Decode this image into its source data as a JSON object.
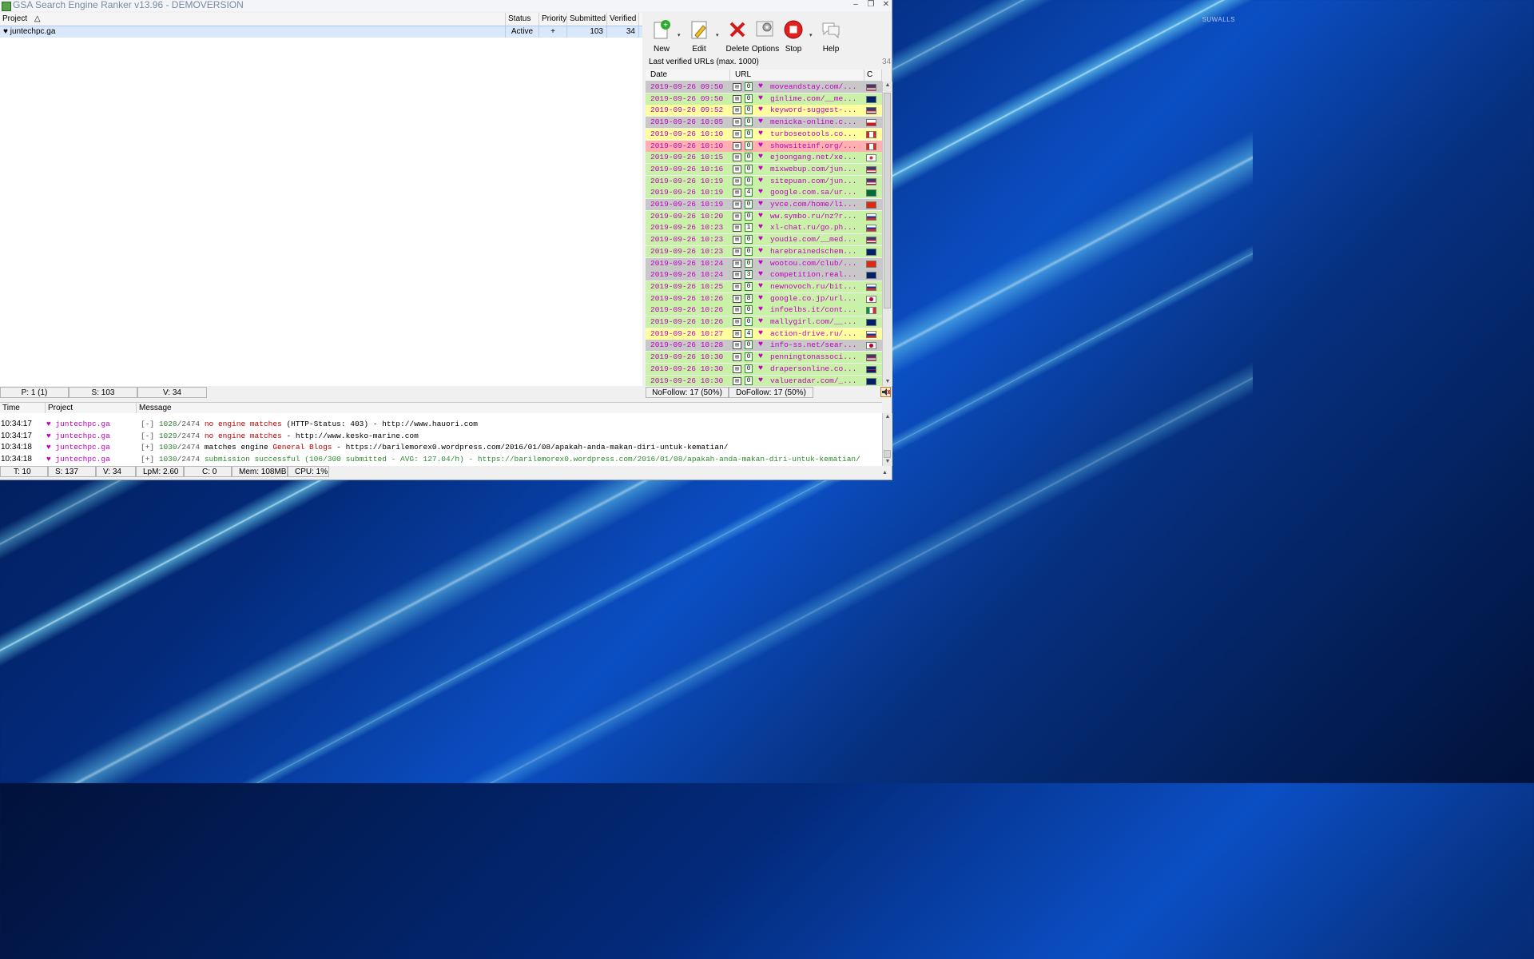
{
  "window": {
    "title": "GSA Search Engine Ranker v13.96 - DEMOVERSION",
    "controls": [
      "–",
      "❐",
      "✕"
    ]
  },
  "desktop": {
    "brand": "SUWALLS"
  },
  "projects": {
    "columns": {
      "project": "Project",
      "sort_indicator": "△",
      "status": "Status",
      "priority": "Priority",
      "submitted": "Submitted",
      "verified": "Verified"
    },
    "row": {
      "name": "juntechpc.ga",
      "status": "Active",
      "priority": "+",
      "submitted": "103",
      "verified": "34"
    }
  },
  "project_status": {
    "p": "P: 1 (1)",
    "s": "S: 103",
    "v": "V: 34"
  },
  "toolbar": {
    "new": "New",
    "edit": "Edit",
    "delete": "Delete",
    "options": "Options",
    "stop": "Stop",
    "help": "Help",
    "dropdown": "▾"
  },
  "verified_urls": {
    "label": "Last verified URLs (max. 1000)",
    "count": "34",
    "columns": {
      "date": "Date",
      "url": "URL",
      "c": "C"
    },
    "rows": [
      {
        "date": "2019-09-26 09:50",
        "n": "0",
        "url": "moveandstay.com/...",
        "bg": "#c8c8c8",
        "flag": "us"
      },
      {
        "date": "2019-09-26 09:50",
        "n": "0",
        "url": "ginlime.com/__me...",
        "bg": "#c9f2a8",
        "flag": "au"
      },
      {
        "date": "2019-09-26 09:52",
        "n": "0",
        "url": "keyword-suggest-...",
        "bg": "#ffff9e",
        "flag": "us"
      },
      {
        "date": "2019-09-26 10:05",
        "n": "0",
        "url": "menicka-online.c...",
        "bg": "#c8c8c8",
        "flag": "cz"
      },
      {
        "date": "2019-09-26 10:10",
        "n": "0",
        "url": "turboseotools.co...",
        "bg": "#ffff9e",
        "flag": "ca"
      },
      {
        "date": "2019-09-26 10:10",
        "n": "0",
        "url": "showsiteinf.org/...",
        "bg": "#ffb0b0",
        "flag": "ca"
      },
      {
        "date": "2019-09-26 10:15",
        "n": "0",
        "url": "ejoongang.net/xe...",
        "bg": "#c9f2a8",
        "flag": "kr"
      },
      {
        "date": "2019-09-26 10:16",
        "n": "0",
        "url": "mixwebup.com/jun...",
        "bg": "#c9f2a8",
        "flag": "us"
      },
      {
        "date": "2019-09-26 10:19",
        "n": "0",
        "url": "sitepuan.com/jun...",
        "bg": "#c9f2a8",
        "flag": "us"
      },
      {
        "date": "2019-09-26 10:19",
        "n": "4",
        "url": "google.com.sa/ur...",
        "bg": "#c9f2a8",
        "flag": "sa"
      },
      {
        "date": "2019-09-26 10:19",
        "n": "0",
        "url": "yvce.com/home/li...",
        "bg": "#c8c8c8",
        "flag": "cn"
      },
      {
        "date": "2019-09-26 10:20",
        "n": "0",
        "url": "ww.symbo.ru/nz?r...",
        "bg": "#c9f2a8",
        "flag": "ru"
      },
      {
        "date": "2019-09-26 10:23",
        "n": "1",
        "url": "xl-chat.ru/go.ph...",
        "bg": "#c9f2a8",
        "flag": "ru"
      },
      {
        "date": "2019-09-26 10:23",
        "n": "0",
        "url": "youdie.com/__med...",
        "bg": "#c9f2a8",
        "flag": "us"
      },
      {
        "date": "2019-09-26 10:23",
        "n": "0",
        "url": "harebrainedschem...",
        "bg": "#c9f2a8",
        "flag": "au"
      },
      {
        "date": "2019-09-26 10:24",
        "n": "0",
        "url": "wootou.com/club/...",
        "bg": "#c8c8c8",
        "flag": "cn"
      },
      {
        "date": "2019-09-26 10:24",
        "n": "3",
        "url": "competition.real...",
        "bg": "#c8c8c8",
        "flag": "au"
      },
      {
        "date": "2019-09-26 10:25",
        "n": "0",
        "url": "newnovoch.ru/bit...",
        "bg": "#c9f2a8",
        "flag": "ru"
      },
      {
        "date": "2019-09-26 10:26",
        "n": "8",
        "url": "google.co.jp/url...",
        "bg": "#c9f2a8",
        "flag": "jp"
      },
      {
        "date": "2019-09-26 10:26",
        "n": "0",
        "url": "infoelbs.it/cont...",
        "bg": "#c9f2a8",
        "flag": "it"
      },
      {
        "date": "2019-09-26 10:26",
        "n": "0",
        "url": "mallygirl.com/__...",
        "bg": "#c9f2a8",
        "flag": "au"
      },
      {
        "date": "2019-09-26 10:27",
        "n": "4",
        "url": "action-drive.ru/...",
        "bg": "#ffff9e",
        "flag": "ru"
      },
      {
        "date": "2019-09-26 10:28",
        "n": "0",
        "url": "info-ss.net/sear...",
        "bg": "#c8c8c8",
        "flag": "jp"
      },
      {
        "date": "2019-09-26 10:30",
        "n": "0",
        "url": "penningtonassoci...",
        "bg": "#c9f2a8",
        "flag": "us"
      },
      {
        "date": "2019-09-26 10:30",
        "n": "0",
        "url": "drapersonline.co...",
        "bg": "#c9f2a8",
        "flag": "gb"
      },
      {
        "date": "2019-09-26 10:30",
        "n": "0",
        "url": "valueradar.com/_...",
        "bg": "#c9f2a8",
        "flag": "au"
      }
    ]
  },
  "follow_stats": {
    "nofollow": "NoFollow: 17 (50%)",
    "dofollow": "DoFollow: 17 (50%)"
  },
  "log": {
    "columns": {
      "time": "Time",
      "project": "Project",
      "message": "Message"
    },
    "rows": [
      {
        "time": "10:34:17",
        "project": "juntechpc.ga",
        "prefix": "[-]",
        "num": "1028",
        "total": "/2474",
        "msg": "no engine matches",
        "detail": " (HTTP-Status: 403) - http://www.hauori.com",
        "kind": "fail"
      },
      {
        "time": "10:34:17",
        "project": "juntechpc.ga",
        "prefix": "[-]",
        "num": "1029",
        "total": "/2474",
        "msg": "no engine matches",
        "detail": " - http://www.kesko-marine.com",
        "kind": "fail"
      },
      {
        "time": "10:34:18",
        "project": "juntechpc.ga",
        "prefix": "[+]",
        "num": "1030",
        "total": "/2474",
        "msg": "matches engine ",
        "engine": "General Blogs",
        "detail": " - https://barilemorex0.wordpress.com/2016/01/08/apakah-anda-makan-diri-untuk-kematian/",
        "kind": "match"
      },
      {
        "time": "10:34:18",
        "project": "juntechpc.ga",
        "prefix": "[+]",
        "num": "1030",
        "total": "/2474",
        "msg": "submission successful",
        "detail": " (106/300 submitted - AVG: 127.04/h) - https://barilemorex0.wordpress.com/2016/01/08/apakah-anda-makan-diri-untuk-kematian/",
        "kind": "success"
      }
    ]
  },
  "bottom_status": {
    "t": "T: 10",
    "s": "S: 137",
    "v": "V: 34",
    "lpm": "LpM: 2.60",
    "c": "C: 0",
    "mem": "Mem: 108MB",
    "cpu": "CPU: 1%"
  },
  "colors": {
    "heart": "#c000c0",
    "selected_row": "#d9e8fb",
    "green_row": "#c9f2a8",
    "yellow_row": "#ffff9e",
    "gray_row": "#c8c8c8",
    "pink_row": "#ffb0b0"
  }
}
